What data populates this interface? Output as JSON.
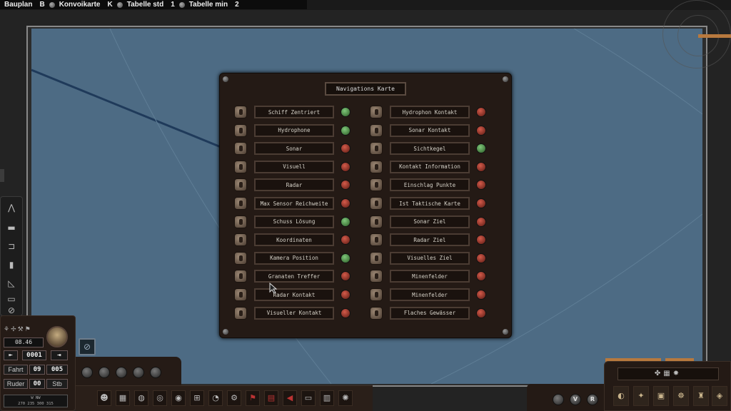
{
  "topbar": {
    "items": [
      {
        "label": "Bauplan",
        "key": "B"
      },
      {
        "label": "Konvoikarte",
        "key": "K"
      },
      {
        "label": "Tabelle std",
        "key": "1"
      },
      {
        "label": "Tabelle min",
        "key": "2"
      }
    ]
  },
  "panel": {
    "title": "Navigations Karte",
    "left_items": [
      {
        "label": "Schiff Zentriert",
        "state": "green"
      },
      {
        "label": "Hydrophone",
        "state": "green"
      },
      {
        "label": "Sonar",
        "state": "red"
      },
      {
        "label": "Visuell",
        "state": "red"
      },
      {
        "label": "Radar",
        "state": "red"
      },
      {
        "label": "Max Sensor Reichweite",
        "state": "red"
      },
      {
        "label": "Schuss Lösung",
        "state": "green"
      },
      {
        "label": "Koordinaten",
        "state": "red"
      },
      {
        "label": "Kamera Position",
        "state": "green"
      },
      {
        "label": "Granaten Treffer",
        "state": "red"
      },
      {
        "label": "Radar Kontakt",
        "state": "red"
      },
      {
        "label": "Visueller Kontakt",
        "state": "red"
      }
    ],
    "right_items": [
      {
        "label": "Hydrophon Kontakt",
        "state": "red"
      },
      {
        "label": "Sonar Kontakt",
        "state": "red"
      },
      {
        "label": "Sichtkegel",
        "state": "green"
      },
      {
        "label": "Kontakt Information",
        "state": "red"
      },
      {
        "label": "Einschlag Punkte",
        "state": "red"
      },
      {
        "label": "Ist Taktische Karte",
        "state": "red"
      },
      {
        "label": "Sonar Ziel",
        "state": "red"
      },
      {
        "label": "Radar Ziel",
        "state": "red"
      },
      {
        "label": "Visuelles Ziel",
        "state": "red"
      },
      {
        "label": "Minenfelder",
        "state": "red"
      },
      {
        "label": "Minenfelder",
        "state": "red"
      },
      {
        "label": "Flaches Gewässer",
        "state": "red"
      }
    ]
  },
  "control": {
    "time": "08.46",
    "value_top": "0001",
    "fahrt_label": "Fahrt",
    "fahrt_a": "09",
    "fahrt_b": "005",
    "ruder_label": "Ruder",
    "ruder_value": "00",
    "ruder_dir": "Stb",
    "scale_top": "W        NW",
    "scale_bottom": "270 235 300 315"
  },
  "mini_buttons": [
    "V",
    "R"
  ],
  "colors": {
    "green_light": "#5fae58",
    "red_light": "#c0483a",
    "map": "#4d6b84",
    "panel": "#241a15"
  }
}
